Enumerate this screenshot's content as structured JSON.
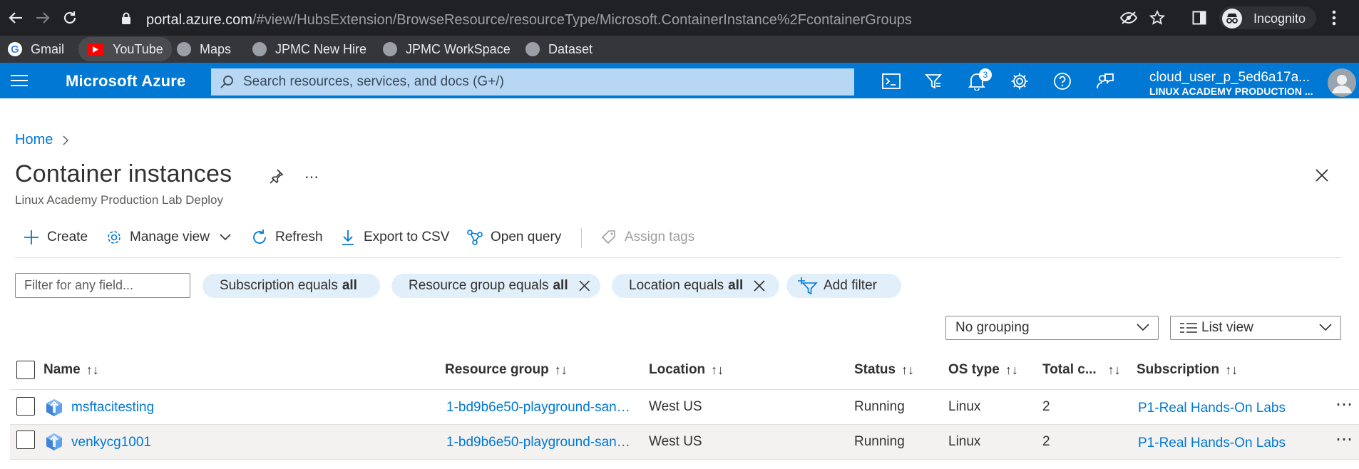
{
  "browser": {
    "url_host": "portal.azure.com",
    "url_path": "/#view/HubsExtension/BrowseResource/resourceType/Microsoft.ContainerInstance%2FcontainerGroups",
    "profile_label": "Incognito",
    "bookmarks": [
      "Gmail",
      "YouTube",
      "Maps",
      "JPMC New Hire",
      "JPMC WorkSpace",
      "Dataset"
    ]
  },
  "azure_header": {
    "title": "Microsoft Azure",
    "search_placeholder": "Search resources, services, and docs (G+/)",
    "notification_count": "3",
    "account_user": "cloud_user_p_5ed6a17a...",
    "account_tenant": "LINUX ACADEMY PRODUCTION ..."
  },
  "breadcrumb": {
    "home": "Home"
  },
  "page": {
    "title": "Container instances",
    "subtitle": "Linux Academy Production Lab Deploy"
  },
  "toolbar": {
    "create": "Create",
    "manage_view": "Manage view",
    "refresh": "Refresh",
    "export_csv": "Export to CSV",
    "open_query": "Open query",
    "assign_tags": "Assign tags"
  },
  "filters": {
    "placeholder": "Filter for any field...",
    "subscription": {
      "label": "Subscription equals",
      "value": "all"
    },
    "resource_group": {
      "label": "Resource group equals",
      "value": "all"
    },
    "location": {
      "label": "Location equals",
      "value": "all"
    },
    "add_filter": "Add filter"
  },
  "view_controls": {
    "grouping": "No grouping",
    "view": "List view"
  },
  "table": {
    "columns": {
      "name": "Name",
      "resource_group": "Resource group",
      "location": "Location",
      "status": "Status",
      "os_type": "OS type",
      "total": "Total c...",
      "subscription": "Subscription"
    },
    "rows": [
      {
        "name": "msftacitesting",
        "resource_group": "1-bd9b6e50-playground-san…",
        "location": "West US",
        "status": "Running",
        "os_type": "Linux",
        "total": "2",
        "subscription": "P1-Real Hands-On Labs"
      },
      {
        "name": "venkycg1001",
        "resource_group": "1-bd9b6e50-playground-san…",
        "location": "West US",
        "status": "Running",
        "os_type": "Linux",
        "total": "2",
        "subscription": "P1-Real Hands-On Labs"
      }
    ]
  },
  "colors": {
    "azure_blue": "#0078d4",
    "pill_bg": "#e1effa",
    "chrome_dark": "#202124"
  }
}
